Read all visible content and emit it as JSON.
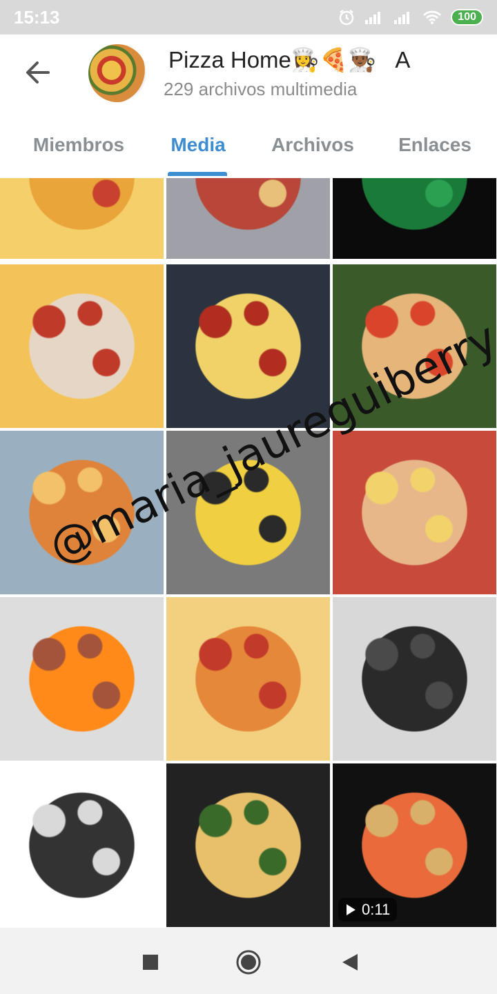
{
  "status_bar": {
    "time": "15:13",
    "battery": "100",
    "icons": [
      "alarm-icon",
      "signal-icon",
      "signal-icon",
      "wifi-icon",
      "battery-icon"
    ]
  },
  "header": {
    "title": "Pizza Home👩‍🍳🍕👨🏾‍🍳",
    "title_trail": "A",
    "subtitle": "229 archivos multimedia"
  },
  "tabs": [
    {
      "label": "Miembros",
      "active": false
    },
    {
      "label": "Media",
      "active": true
    },
    {
      "label": "Archivos",
      "active": false
    },
    {
      "label": "Enlaces",
      "active": false
    }
  ],
  "media": [
    {
      "name": "pepperoni-pizza-square",
      "colors": [
        "#e9a43a",
        "#c8402e",
        "#f5d06a"
      ]
    },
    {
      "name": "pepperoni-pizza-pan",
      "colors": [
        "#b8473a",
        "#e9c07a",
        "#a0a0a8"
      ]
    },
    {
      "name": "green-pan",
      "colors": [
        "#1a7a3a",
        "#2aa050",
        "#0b0b0b"
      ]
    },
    {
      "name": "hands-cutting-pizza",
      "colors": [
        "#e6d6c6",
        "#c03a2a",
        "#f3c35a"
      ]
    },
    {
      "name": "pepperoni-cheese-pizza",
      "colors": [
        "#f0d268",
        "#b02d1f",
        "#2b3340"
      ]
    },
    {
      "name": "basil-tomato-pizza",
      "colors": [
        "#e6b57a",
        "#d9452a",
        "#3b5a2a"
      ]
    },
    {
      "name": "baked-cheese-pizza",
      "colors": [
        "#e0833a",
        "#f2c16a",
        "#9ab0c0"
      ]
    },
    {
      "name": "pizza-on-granite",
      "colors": [
        "#f0d040",
        "#2a2a2a",
        "#7a7a7a"
      ]
    },
    {
      "name": "ham-pineapple-pizza",
      "colors": [
        "#e7b78a",
        "#f2d26a",
        "#c84a3a"
      ]
    },
    {
      "name": "brick-oven-fire",
      "colors": [
        "#ff8a1a",
        "#a3543a",
        "#ddd"
      ]
    },
    {
      "name": "sliced-supreme-pizza",
      "colors": [
        "#e6883a",
        "#c23a2a",
        "#f2d080"
      ]
    },
    {
      "name": "black-oven-door",
      "colors": [
        "#2a2a2a",
        "#4a4a4a",
        "#d8d8d8"
      ]
    },
    {
      "name": "steel-pizza-oven",
      "colors": [
        "#333333",
        "#d9d9d9",
        "#ffffff"
      ]
    },
    {
      "name": "basil-pizza-cutting",
      "colors": [
        "#e8c06a",
        "#3a6a2a",
        "#222"
      ]
    },
    {
      "name": "pizza-in-oven-video",
      "colors": [
        "#e96a3a",
        "#d9b06a",
        "#111"
      ],
      "duration": "0:11"
    }
  ],
  "watermark": "@maria_jaureguiberry",
  "nav": [
    "recents-button",
    "home-button",
    "back-button"
  ]
}
